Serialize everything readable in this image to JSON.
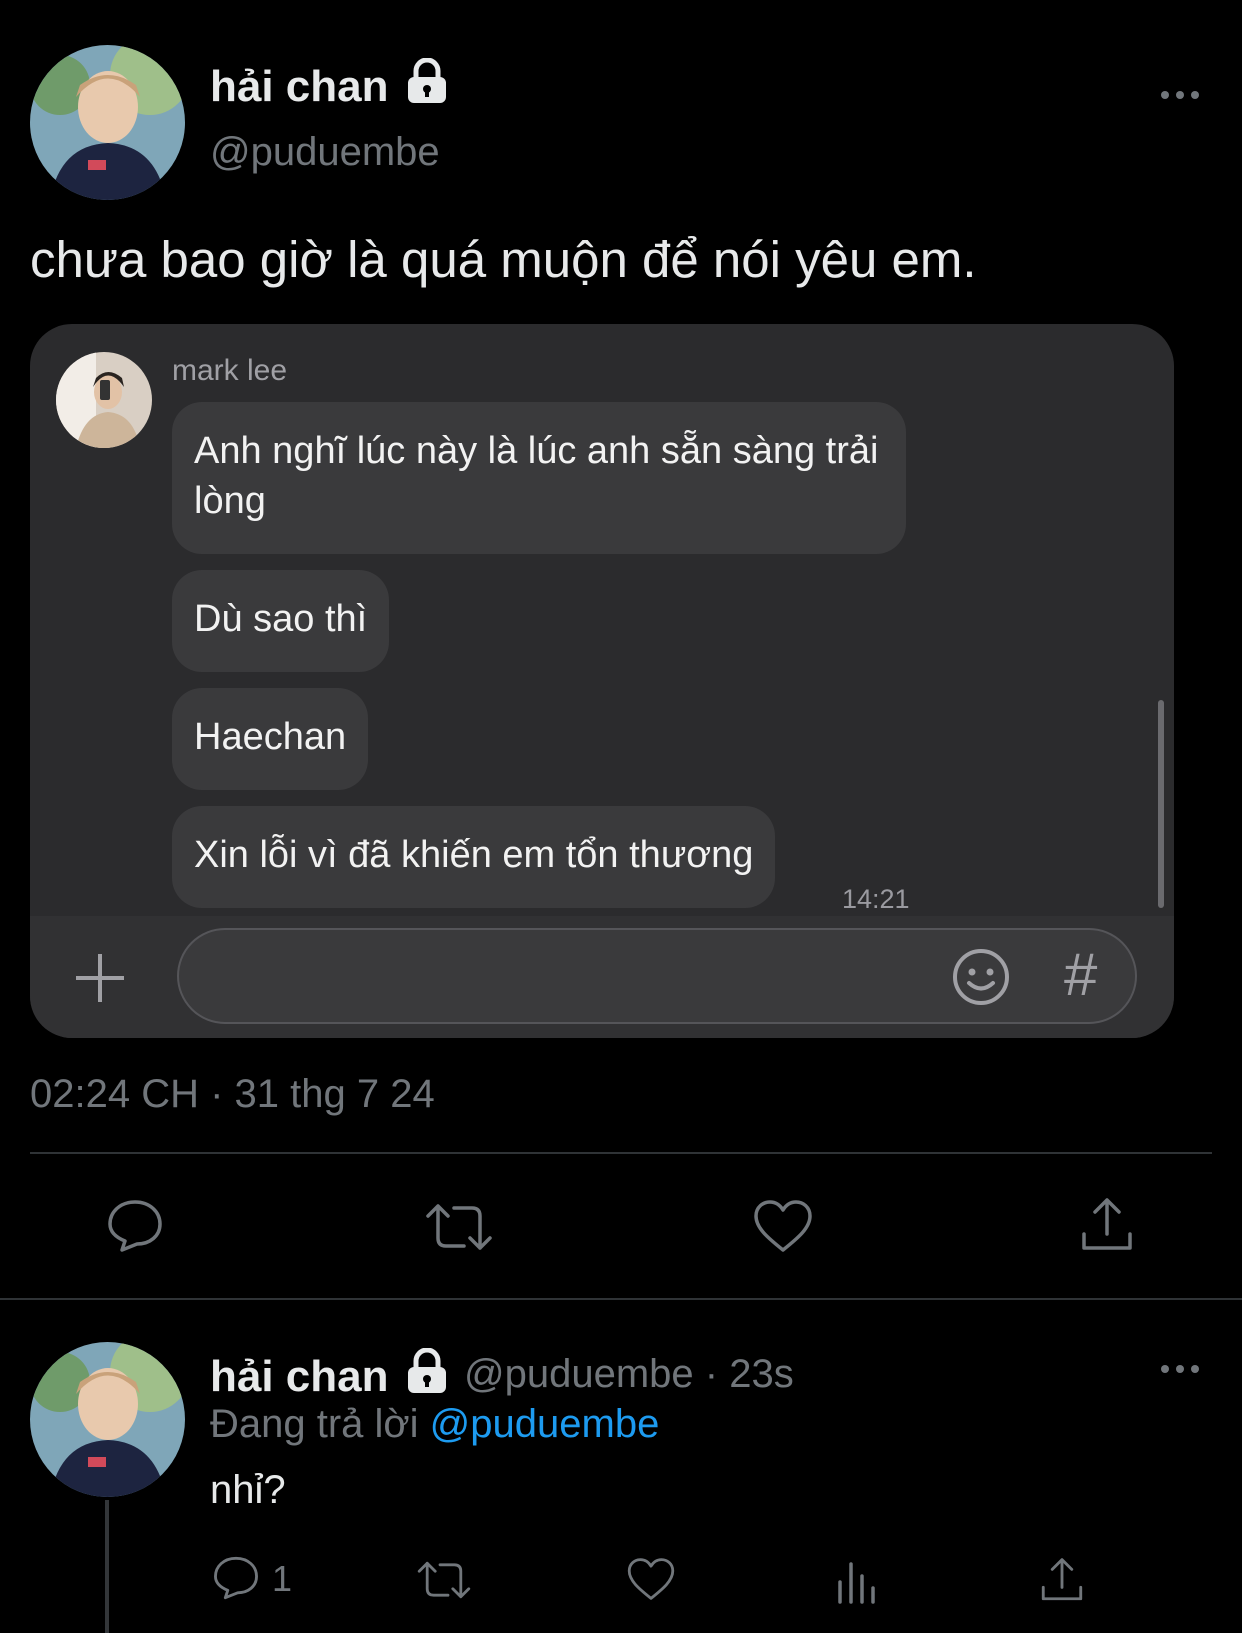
{
  "tweet": {
    "author_name": "hải chan",
    "author_handle": "@puduembe",
    "more_icon": "more-horizontal-icon",
    "text": "chưa bao giờ là quá muộn để nói yêu em.",
    "timestamp": "02:24 CH · 31 thg 7 24"
  },
  "chat": {
    "sender": "mark lee",
    "messages": [
      "Anh nghĩ lúc này là lúc anh sẵn sàng trải lòng",
      "Dù sao thì",
      "Haechan",
      "Xin lỗi vì đã khiến em tổn thương"
    ],
    "time": "14:21",
    "input_placeholder": "",
    "hash_symbol": "#"
  },
  "actions": [
    "reply-icon",
    "retweet-icon",
    "like-icon",
    "share-icon"
  ],
  "reply": {
    "author_name": "hải chan",
    "meta": "@puduembe · 23s",
    "replying_prefix": "Đang trả lời",
    "replying_to": "@puduembe",
    "text": "nhỉ?",
    "reply_count": "1"
  },
  "colors": {
    "background": "#000000",
    "text": "#e7e9ea",
    "muted": "#71767b",
    "link": "#1d9bf0",
    "card": "#2b2b2d",
    "bubble": "#3a3a3c"
  }
}
